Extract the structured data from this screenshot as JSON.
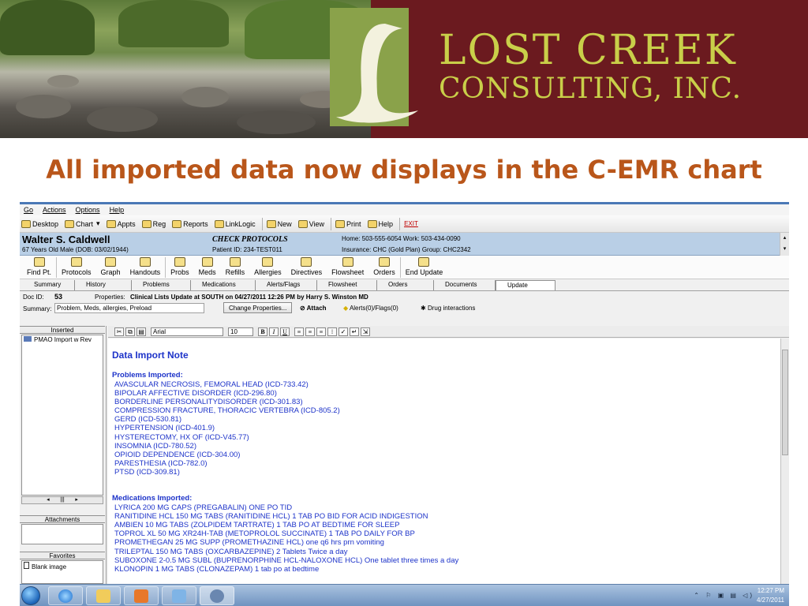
{
  "banner": {
    "company_line1": "LOST CREEK",
    "company_line2": "CONSULTING, INC.",
    "logo_mark": "L-swoosh"
  },
  "slide": {
    "title": "All imported data now displays in the C-EMR chart",
    "title_color": "#b9561a"
  },
  "menu": [
    "Go",
    "Actions",
    "Options",
    "Help"
  ],
  "toolbar": {
    "items": [
      {
        "label": "Desktop",
        "icon": "desktop-icon"
      },
      {
        "label": "Chart",
        "icon": "folder-icon"
      },
      {
        "label": "Appts",
        "icon": "clock-icon"
      },
      {
        "label": "Reg",
        "icon": "pen-icon"
      },
      {
        "label": "Reports",
        "icon": "reports-icon"
      },
      {
        "label": "LinkLogic",
        "icon": "chain-icon"
      },
      {
        "label": "New",
        "icon": "new-icon"
      },
      {
        "label": "View",
        "icon": "view-icon"
      },
      {
        "label": "Print",
        "icon": "printer-icon"
      },
      {
        "label": "Help",
        "icon": "help-icon"
      }
    ],
    "exit_label": "EXIT"
  },
  "patient": {
    "name": "Walter S. Caldwell",
    "age_line": "67 Years Old Male (DOB: 03/02/1944)",
    "protocols": "CHECK PROTOCOLS",
    "patient_id": "Patient ID: 234-TEST011",
    "phones": "Home: 503-555-6054   Work: 503-434-0090",
    "insurance": "Insurance: CHC (Gold Plan) Group: CHC2342"
  },
  "modules": [
    {
      "label": "Find Pt.",
      "icon": "find-patient-icon"
    },
    {
      "label": "Protocols",
      "icon": "protocols-icon"
    },
    {
      "label": "Graph",
      "icon": "graph-icon"
    },
    {
      "label": "Handouts",
      "icon": "handouts-icon"
    },
    {
      "label": "Probs",
      "icon": "problems-icon"
    },
    {
      "label": "Meds",
      "icon": "meds-icon"
    },
    {
      "label": "Refills",
      "icon": "refills-icon"
    },
    {
      "label": "Allergies",
      "icon": "allergies-icon"
    },
    {
      "label": "Directives",
      "icon": "directives-icon"
    },
    {
      "label": "Flowsheet",
      "icon": "flowsheet-icon"
    },
    {
      "label": "Orders",
      "icon": "orders-icon"
    },
    {
      "label": "End Update",
      "icon": "end-update-icon"
    }
  ],
  "tabs": [
    "Summary",
    "History",
    "Problems",
    "Medications",
    "Alerts/Flags",
    "Flowsheet",
    "Orders",
    "Documents",
    "Update"
  ],
  "active_tab": "Update",
  "doc": {
    "id_label": "Doc ID:",
    "id_value": "53",
    "props_label": "Properties:",
    "props_value": "Clinical Lists Update at SOUTH on 04/27/2011 12:26 PM by Harry S. Winston MD",
    "summary_label": "Summary:",
    "summary_value": "Problem, Meds, allergies, Preload",
    "change_props": "Change Properties...",
    "attach": "Attach",
    "alerts": "Alerts(0)/Flags(0)",
    "drug": "Drug interactions"
  },
  "left_panel": {
    "inserted_label": "Inserted",
    "inserted_item": "PMAO Import w Rev",
    "attachments_label": "Attachments",
    "favorites_label": "Favorites",
    "favorites_item": "Blank image"
  },
  "editor": {
    "font": "Arial",
    "size": "10",
    "note_title": "Data Import Note",
    "problems_title": "Problems Imported:",
    "problems": [
      "AVASCULAR NECROSIS, FEMORAL HEAD (ICD-733.42)",
      "BIPOLAR AFFECTIVE DISORDER (ICD-296.80)",
      "BORDERLINE PERSONALITYDISORDER (ICD-301.83)",
      "COMPRESSION FRACTURE, THORACIC VERTEBRA (ICD-805.2)",
      "GERD (ICD-530.81)",
      "HYPERTENSION (ICD-401.9)",
      "HYSTERECTOMY, HX OF (ICD-V45.77)",
      "INSOMNIA (ICD-780.52)",
      "OPIOID DEPENDENCE (ICD-304.00)",
      "PARESTHESIA (ICD-782.0)",
      "PTSD (ICD-309.81)"
    ],
    "meds_title": "Medications Imported:",
    "meds": [
      "LYRICA 200 MG CAPS (PREGABALIN) ONE PO TID",
      "RANITIDINE HCL 150 MG TABS (RANITIDINE HCL) 1 TAB PO BID FOR ACID INDIGESTION",
      "AMBIEN 10 MG TABS (ZOLPIDEM TARTRATE) 1 TAB PO AT BEDTIME FOR SLEEP",
      "TOPROL XL 50 MG XR24H-TAB (METOPROLOL SUCCINATE) 1 TAB PO DAILY FOR BP",
      "PROMETHEGAN 25 MG SUPP (PROMETHAZINE HCL) one q6 hrs prn vomiting",
      "TRILEPTAL 150 MG TABS (OXCARBAZEPINE) 2 Tablets Twice a day",
      "SUBOXONE 2-0.5 MG SUBL (BUPRENORPHINE HCL-NALOXONE HCL) One tablet three times a day",
      "KLONOPIN 1 MG TABS (CLONAZEPAM) 1 tab po at bedtime"
    ],
    "text_color": "#1d33c9"
  },
  "taskbar": {
    "time": "12:27 PM",
    "date": "4/27/2011",
    "apps": [
      "ie-icon",
      "explorer-icon",
      "media-icon",
      "paint-icon",
      "people-icon"
    ]
  }
}
